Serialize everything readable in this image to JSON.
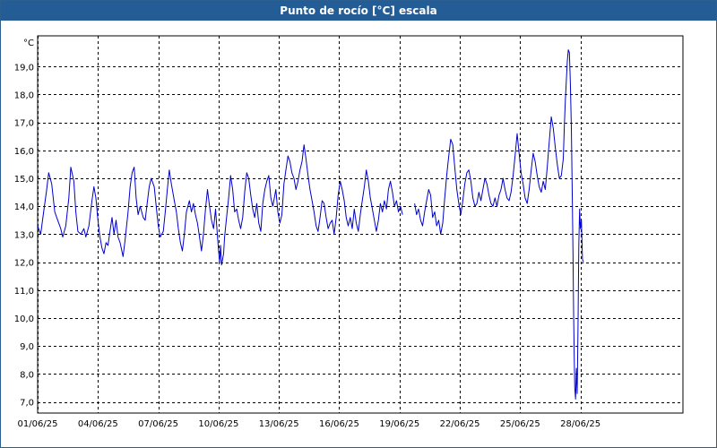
{
  "window": {
    "title": "Punto de rocío [°C] escala"
  },
  "colors": {
    "title_bar": "#245d96",
    "title_text": "#ffffff",
    "series": "#0000cc",
    "grid": "#000000",
    "plot_background": "#ffffff"
  },
  "chart_data": {
    "type": "line",
    "title": "Punto de rocío [°C] escala",
    "ylabel": "°C",
    "xlabel": "",
    "grid": true,
    "legend": "none",
    "ylim": [
      6.6,
      20.1
    ],
    "xlim": [
      0,
      32.1
    ],
    "y_ticks": [
      7,
      8,
      9,
      10,
      11,
      12,
      13,
      14,
      15,
      16,
      17,
      18,
      19
    ],
    "y_tick_labels": [
      "7,0",
      "8,0",
      "9,0",
      "10,0",
      "11,0",
      "12,0",
      "13,0",
      "14,0",
      "15,0",
      "16,0",
      "17,0",
      "18,0",
      "19,0"
    ],
    "x_ticks": [
      0,
      3,
      6,
      9,
      12,
      15,
      18,
      21,
      24,
      27
    ],
    "x_tick_labels": [
      "01/06/25",
      "04/06/25",
      "07/06/25",
      "10/06/25",
      "13/06/25",
      "16/06/25",
      "19/06/25",
      "22/06/25",
      "25/06/25",
      "28/06/25"
    ],
    "series": [
      {
        "segments": [
          [
            [
              0.0,
              13.3
            ],
            [
              0.15,
              13.0
            ],
            [
              0.3,
              13.8
            ],
            [
              0.45,
              14.6
            ],
            [
              0.55,
              15.2
            ],
            [
              0.7,
              14.8
            ],
            [
              0.85,
              13.8
            ],
            [
              1.0,
              13.5
            ],
            [
              1.15,
              13.2
            ],
            [
              1.25,
              12.9
            ],
            [
              1.4,
              13.3
            ],
            [
              1.55,
              14.3
            ],
            [
              1.65,
              15.4
            ],
            [
              1.8,
              14.9
            ],
            [
              1.9,
              13.8
            ],
            [
              2.0,
              13.1
            ],
            [
              2.15,
              13.0
            ],
            [
              2.3,
              13.2
            ],
            [
              2.4,
              12.9
            ],
            [
              2.55,
              13.3
            ],
            [
              2.7,
              14.2
            ],
            [
              2.8,
              14.7
            ],
            [
              2.9,
              14.3
            ],
            [
              3.0,
              13.5
            ],
            [
              3.1,
              12.9
            ],
            [
              3.2,
              12.5
            ],
            [
              3.3,
              12.3
            ],
            [
              3.4,
              12.7
            ],
            [
              3.5,
              12.6
            ],
            [
              3.6,
              13.1
            ],
            [
              3.7,
              13.6
            ],
            [
              3.8,
              13.0
            ],
            [
              3.9,
              13.5
            ],
            [
              4.0,
              12.9
            ],
            [
              4.1,
              12.7
            ],
            [
              4.25,
              12.2
            ],
            [
              4.35,
              12.8
            ],
            [
              4.5,
              13.8
            ],
            [
              4.6,
              14.7
            ],
            [
              4.7,
              15.2
            ],
            [
              4.8,
              15.4
            ],
            [
              4.9,
              14.3
            ],
            [
              5.0,
              13.7
            ],
            [
              5.1,
              14.0
            ],
            [
              5.25,
              13.6
            ],
            [
              5.35,
              13.5
            ],
            [
              5.45,
              14.1
            ],
            [
              5.55,
              14.7
            ],
            [
              5.65,
              15.0
            ],
            [
              5.8,
              14.7
            ],
            [
              5.9,
              14.0
            ],
            [
              6.0,
              13.3
            ],
            [
              6.1,
              12.9
            ],
            [
              6.25,
              13.1
            ],
            [
              6.35,
              13.8
            ],
            [
              6.45,
              14.6
            ],
            [
              6.55,
              15.3
            ],
            [
              6.65,
              14.8
            ],
            [
              6.8,
              14.2
            ],
            [
              6.9,
              13.8
            ],
            [
              7.0,
              13.2
            ],
            [
              7.1,
              12.7
            ],
            [
              7.2,
              12.4
            ],
            [
              7.3,
              13.0
            ],
            [
              7.4,
              13.8
            ],
            [
              7.55,
              14.2
            ],
            [
              7.65,
              13.8
            ],
            [
              7.75,
              14.1
            ],
            [
              7.85,
              13.7
            ],
            [
              7.95,
              13.4
            ],
            [
              8.05,
              12.9
            ],
            [
              8.15,
              12.4
            ],
            [
              8.25,
              13.0
            ],
            [
              8.35,
              13.9
            ],
            [
              8.45,
              14.6
            ],
            [
              8.55,
              14.0
            ],
            [
              8.65,
              13.5
            ],
            [
              8.75,
              13.2
            ],
            [
              8.85,
              13.9
            ],
            [
              8.95,
              12.9
            ],
            [
              9.0,
              12.4
            ],
            [
              9.05,
              12.0
            ],
            [
              9.1,
              12.6
            ],
            [
              9.15,
              11.9
            ],
            [
              9.25,
              12.3
            ],
            [
              9.3,
              12.9
            ],
            [
              9.4,
              13.6
            ],
            [
              9.5,
              14.3
            ],
            [
              9.6,
              15.1
            ],
            [
              9.7,
              14.6
            ],
            [
              9.8,
              13.8
            ],
            [
              9.9,
              13.9
            ],
            [
              10.0,
              13.5
            ],
            [
              10.1,
              13.2
            ],
            [
              10.2,
              13.6
            ],
            [
              10.3,
              14.5
            ],
            [
              10.4,
              15.2
            ],
            [
              10.5,
              15.0
            ],
            [
              10.6,
              14.4
            ],
            [
              10.7,
              13.9
            ],
            [
              10.8,
              13.6
            ],
            [
              10.9,
              14.1
            ],
            [
              11.0,
              13.4
            ],
            [
              11.1,
              13.1
            ],
            [
              11.2,
              14.1
            ],
            [
              11.3,
              14.6
            ],
            [
              11.4,
              14.9
            ],
            [
              11.5,
              15.1
            ],
            [
              11.6,
              14.3
            ],
            [
              11.7,
              14.0
            ],
            [
              11.85,
              14.6
            ],
            [
              11.95,
              13.8
            ],
            [
              12.05,
              13.4
            ],
            [
              12.15,
              13.7
            ],
            [
              12.25,
              14.8
            ],
            [
              12.35,
              15.3
            ],
            [
              12.45,
              15.8
            ],
            [
              12.55,
              15.6
            ],
            [
              12.65,
              15.2
            ],
            [
              12.75,
              15.0
            ],
            [
              12.85,
              14.6
            ],
            [
              12.95,
              14.9
            ],
            [
              13.05,
              15.3
            ],
            [
              13.15,
              15.6
            ],
            [
              13.25,
              16.2
            ],
            [
              13.35,
              15.7
            ],
            [
              13.45,
              15.1
            ],
            [
              13.55,
              14.6
            ],
            [
              13.65,
              14.2
            ],
            [
              13.75,
              13.8
            ],
            [
              13.85,
              13.3
            ],
            [
              13.95,
              13.1
            ],
            [
              14.05,
              13.6
            ],
            [
              14.15,
              14.2
            ],
            [
              14.25,
              14.1
            ],
            [
              14.35,
              13.6
            ],
            [
              14.45,
              13.2
            ],
            [
              14.55,
              13.4
            ],
            [
              14.65,
              13.5
            ],
            [
              14.75,
              13.0
            ],
            [
              14.85,
              13.6
            ],
            [
              14.95,
              14.4
            ],
            [
              15.05,
              14.9
            ],
            [
              15.15,
              14.6
            ],
            [
              15.25,
              14.2
            ],
            [
              15.35,
              13.6
            ],
            [
              15.45,
              13.3
            ],
            [
              15.55,
              13.6
            ],
            [
              15.65,
              13.2
            ],
            [
              15.75,
              13.9
            ],
            [
              15.85,
              13.4
            ],
            [
              15.95,
              13.1
            ],
            [
              16.05,
              13.7
            ],
            [
              16.15,
              14.2
            ],
            [
              16.25,
              14.7
            ],
            [
              16.35,
              15.3
            ],
            [
              16.45,
              14.9
            ],
            [
              16.55,
              14.3
            ],
            [
              16.65,
              13.9
            ],
            [
              16.75,
              13.5
            ],
            [
              16.85,
              13.1
            ],
            [
              16.95,
              13.5
            ],
            [
              17.05,
              14.1
            ],
            [
              17.15,
              13.8
            ],
            [
              17.25,
              14.2
            ],
            [
              17.35,
              13.9
            ],
            [
              17.45,
              14.6
            ],
            [
              17.55,
              14.9
            ],
            [
              17.65,
              14.5
            ],
            [
              17.75,
              14.0
            ],
            [
              17.85,
              14.2
            ],
            [
              17.95,
              13.8
            ],
            [
              18.05,
              14.0
            ],
            [
              18.15,
              13.7
            ]
          ],
          [
            [
              18.75,
              14.1
            ],
            [
              18.85,
              13.7
            ],
            [
              18.95,
              13.9
            ],
            [
              19.05,
              13.5
            ],
            [
              19.15,
              13.3
            ],
            [
              19.25,
              13.8
            ],
            [
              19.35,
              14.2
            ],
            [
              19.45,
              14.6
            ],
            [
              19.55,
              14.4
            ],
            [
              19.65,
              13.6
            ],
            [
              19.75,
              13.8
            ],
            [
              19.85,
              13.3
            ],
            [
              19.95,
              13.5
            ],
            [
              20.05,
              13.0
            ],
            [
              20.15,
              13.4
            ],
            [
              20.25,
              14.3
            ],
            [
              20.35,
              15.1
            ],
            [
              20.45,
              15.8
            ],
            [
              20.55,
              16.4
            ],
            [
              20.65,
              16.2
            ],
            [
              20.75,
              15.4
            ],
            [
              20.85,
              14.6
            ],
            [
              20.95,
              14.1
            ],
            [
              21.05,
              13.7
            ],
            [
              21.15,
              14.2
            ],
            [
              21.25,
              14.8
            ],
            [
              21.35,
              15.2
            ],
            [
              21.45,
              15.3
            ],
            [
              21.55,
              14.9
            ],
            [
              21.65,
              14.3
            ],
            [
              21.75,
              14.0
            ],
            [
              21.85,
              14.1
            ],
            [
              21.95,
              14.5
            ],
            [
              22.05,
              14.2
            ],
            [
              22.15,
              14.6
            ],
            [
              22.25,
              15.0
            ],
            [
              22.35,
              14.8
            ],
            [
              22.45,
              14.4
            ],
            [
              22.55,
              14.1
            ],
            [
              22.65,
              14.0
            ],
            [
              22.75,
              14.3
            ],
            [
              22.85,
              14.0
            ],
            [
              22.95,
              14.4
            ],
            [
              23.05,
              14.6
            ],
            [
              23.15,
              15.0
            ],
            [
              23.25,
              14.6
            ],
            [
              23.35,
              14.3
            ],
            [
              23.45,
              14.2
            ],
            [
              23.55,
              14.5
            ],
            [
              23.65,
              15.1
            ],
            [
              23.75,
              15.8
            ],
            [
              23.85,
              16.6
            ],
            [
              23.95,
              15.9
            ],
            [
              24.05,
              15.2
            ],
            [
              24.15,
              14.8
            ],
            [
              24.25,
              14.3
            ],
            [
              24.35,
              14.1
            ],
            [
              24.45,
              14.6
            ],
            [
              24.55,
              15.3
            ],
            [
              24.65,
              15.9
            ],
            [
              24.75,
              15.6
            ],
            [
              24.85,
              15.1
            ],
            [
              24.95,
              14.7
            ],
            [
              25.05,
              14.5
            ],
            [
              25.15,
              14.9
            ],
            [
              25.25,
              14.6
            ],
            [
              25.35,
              15.4
            ],
            [
              25.45,
              16.3
            ],
            [
              25.55,
              17.2
            ],
            [
              25.65,
              16.8
            ],
            [
              25.75,
              16.1
            ],
            [
              25.85,
              15.5
            ],
            [
              25.95,
              15.0
            ],
            [
              26.05,
              15.1
            ],
            [
              26.15,
              15.7
            ],
            [
              26.2,
              16.9
            ],
            [
              26.25,
              17.8
            ],
            [
              26.3,
              18.5
            ],
            [
              26.35,
              19.2
            ],
            [
              26.4,
              19.6
            ],
            [
              26.45,
              19.5
            ],
            [
              26.5,
              18.4
            ],
            [
              26.55,
              16.8
            ],
            [
              26.6,
              14.2
            ],
            [
              26.63,
              12.4
            ],
            [
              26.66,
              10.2
            ],
            [
              26.69,
              8.6
            ],
            [
              26.72,
              7.5
            ],
            [
              26.76,
              7.1
            ],
            [
              26.8,
              8.2
            ],
            [
              26.84,
              7.3
            ],
            [
              26.88,
              9.6
            ],
            [
              26.92,
              12.6
            ],
            [
              26.96,
              13.9
            ],
            [
              27.0,
              13.2
            ],
            [
              27.05,
              13.5
            ],
            [
              27.1,
              12.1
            ],
            [
              27.15,
              12.0
            ]
          ]
        ]
      }
    ]
  }
}
